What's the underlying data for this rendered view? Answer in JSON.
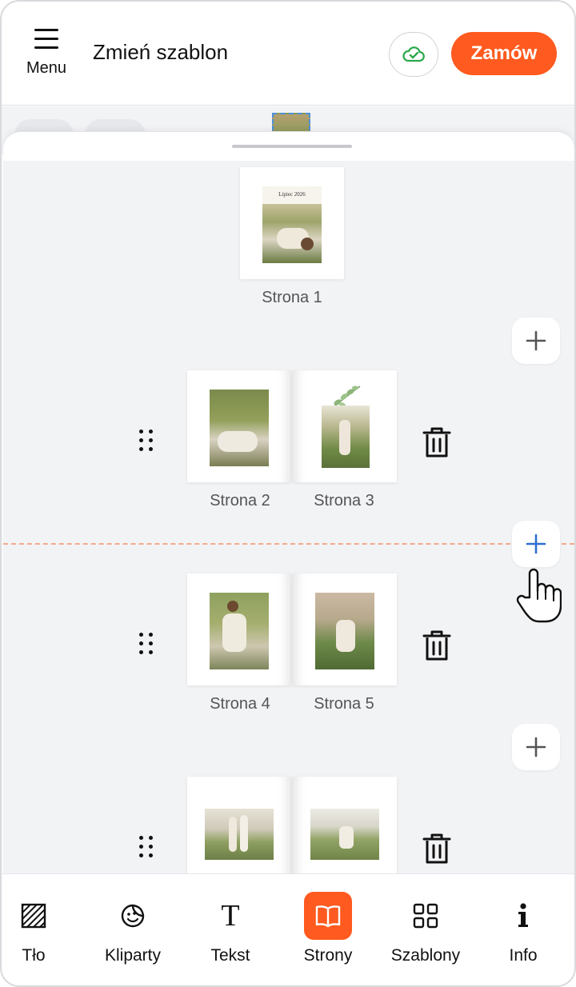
{
  "header": {
    "menu_label": "Menu",
    "title": "Zmień szablon",
    "save_icon": "cloud-check-icon",
    "order_label": "Zamów"
  },
  "pages": {
    "cover": {
      "label": "Strona 1",
      "date_text": "Lipiec 2026"
    },
    "spread_1": {
      "left_label": "Strona 2",
      "right_label": "Strona 3"
    },
    "spread_2": {
      "left_label": "Strona 4",
      "right_label": "Strona 5"
    },
    "spread_3": {
      "left_label": "",
      "right_label": ""
    }
  },
  "toolbar": {
    "items": [
      {
        "label": "Tło",
        "icon": "background-pattern-icon"
      },
      {
        "label": "Kliparty",
        "icon": "sticker-icon"
      },
      {
        "label": "Tekst",
        "icon": "text-icon"
      },
      {
        "label": "Strony",
        "icon": "book-pages-icon",
        "active": true
      },
      {
        "label": "Szablony",
        "icon": "grid-layout-icon"
      },
      {
        "label": "Info",
        "icon": "info-icon"
      }
    ]
  },
  "colors": {
    "accent": "#ff5a1f",
    "insert_line": "#f3a98f",
    "plus_active": "#2f6fd0",
    "cloud_ok": "#2aa84a"
  }
}
